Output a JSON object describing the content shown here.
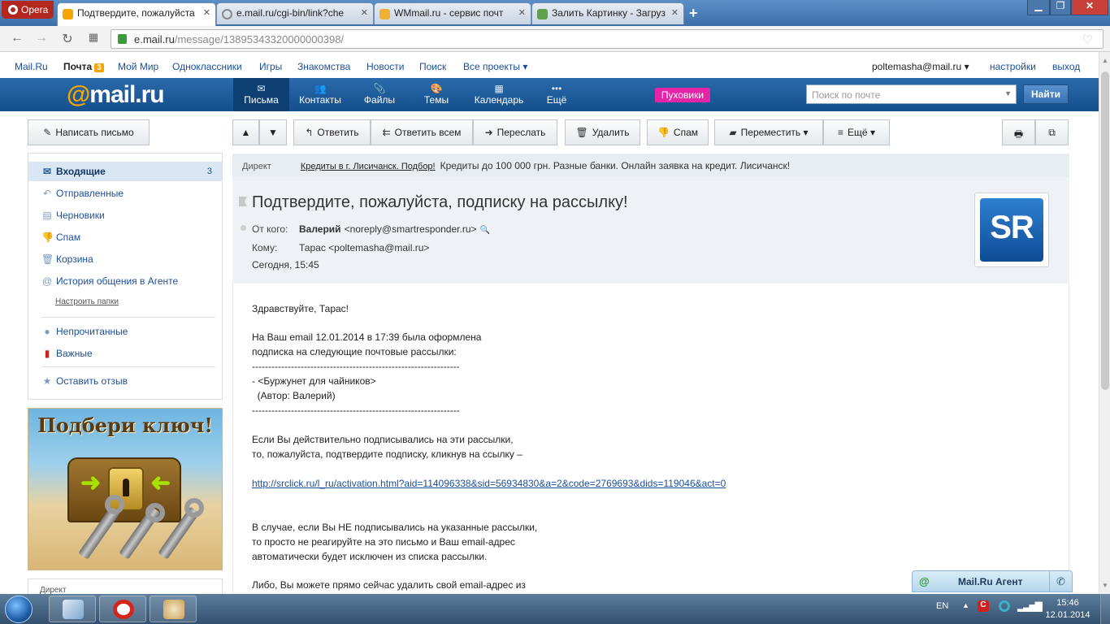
{
  "browser": {
    "menu_label": "Opera",
    "tabs": [
      {
        "title": "Подтвердите, пожалуйста",
        "color": "#f6a400"
      },
      {
        "title": "e.mail.ru/cgi-bin/link?che",
        "color": "#cfcfcf"
      },
      {
        "title": "WMmail.ru - сервис почт",
        "color": "#f0b030"
      },
      {
        "title": "Залить Картинку - Загруз",
        "color": "#5fa04a"
      }
    ],
    "new_tab": "+",
    "address": {
      "host": "e.mail.ru",
      "path": "/message/13895343320000000398/"
    }
  },
  "portal": {
    "links": [
      "Mail.Ru",
      "Мой Мир",
      "Одноклассники",
      "Игры",
      "Знакомства",
      "Новости",
      "Поиск",
      "Все проекты"
    ],
    "mail_label": "Почта",
    "mail_count": "3",
    "user_email": "poltemasha@mail.ru",
    "settings": "настройки",
    "logout": "выход"
  },
  "header": {
    "logo_at": "@",
    "logo_text": "mail.ru",
    "nav": [
      {
        "label": "Письма",
        "icon": "✉"
      },
      {
        "label": "Контакты",
        "icon": "👥"
      },
      {
        "label": "Файлы",
        "icon": "📎"
      },
      {
        "label": "Темы",
        "icon": "🎨"
      },
      {
        "label": "Календарь",
        "icon": "▦"
      },
      {
        "label": "Ещё",
        "icon": "•••"
      }
    ],
    "promo": "Пуховики",
    "search_placeholder": "Поиск по почте",
    "find": "Найти"
  },
  "toolbar": {
    "compose": "Написать письмо",
    "reply": "Ответить",
    "reply_all": "Ответить всем",
    "forward": "Переслать",
    "delete": "Удалить",
    "spam": "Спам",
    "move": "Переместить",
    "more": "Ещё"
  },
  "folders": [
    {
      "label": "Входящие",
      "count": "3"
    },
    {
      "label": "Отправленные"
    },
    {
      "label": "Черновики"
    },
    {
      "label": "Спам"
    },
    {
      "label": "Корзина"
    },
    {
      "label": "История общения в Агенте"
    }
  ],
  "setup_folders": "Настроить папки",
  "filters": [
    "Непрочитанные",
    "Важные"
  ],
  "feedback": "Оставить отзыв",
  "banner_title": "Подбери ключ!",
  "left_lower_label": "Директ",
  "ad": {
    "label": "Директ",
    "link": "Кредиты в г. Лисичанск. Подбор!",
    "text": "Кредиты до 100 000 грн. Разные банки. Онлайн заявка на кредит. Лисичанск!"
  },
  "message": {
    "subject": "Подтвердите, пожалуйста, подписку на рассылку!",
    "from_label": "От кого:",
    "from_name": "Валерий",
    "from_email": "<noreply@smartresponder.ru>",
    "to_label": "Кому:",
    "to_value": "Тарас <poltemasha@mail.ru>",
    "date": "Сегодня, 15:45",
    "sender_logo": "SR",
    "body": {
      "greeting": "Здравствуйте, Тарас!",
      "l1": "На Ваш email 12.01.2014 в 17:39 была оформлена",
      "l2": "подписка на следующие почтовые рассылки:",
      "dash1": "----------------------------------------------------------------",
      "item": "- <Буржунет для чайников>",
      "author": "  (Автор: Валерий)",
      "dash2": "----------------------------------------------------------------",
      "l3": "Если Вы действительно подписывались на эти рассылки,",
      "l4": "то, пожалуйста, подтвердите подписку, кликнув на ссылку –",
      "link": "http://srclick.ru/l_ru/activation.html?aid=114096338&sid=56934830&a=2&code=2769693&dids=119046&act=0",
      "l5": "В случае, если Вы НЕ подписывались на указанные рассылки,",
      "l6": "то просто не реагируйте на это письмо и Ваш email-адрес",
      "l7": "автоматически будет исключен из списка рассылки.",
      "l8": "Либо, Вы можете прямо сейчас удалить свой email-адрес из"
    }
  },
  "agent": {
    "title": "Mail.Ru Агент",
    "at": "@"
  },
  "taskbar": {
    "lang": "EN",
    "time": "15:46",
    "date": "12.01.2014"
  },
  "colors": {
    "header_blue": "#1d5d9f",
    "accent_orange": "#f6a400",
    "promo_pink": "#e524a8"
  }
}
